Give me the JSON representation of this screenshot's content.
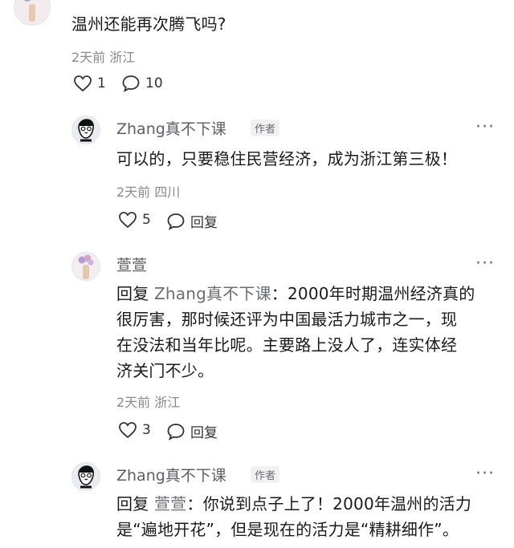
{
  "root_comment": {
    "text": "温州还能再次腾飞吗?",
    "meta": "2天前 浙江",
    "like_count": "1",
    "reply_count": "10"
  },
  "replies": [
    {
      "username": "Zhang真不下课",
      "badge": "作者",
      "text": "可以的，只要稳住民营经济，成为浙江第三极！",
      "meta": "2天前 四川",
      "like_count": "5",
      "reply_label": "回复",
      "more": "···"
    },
    {
      "username": "萱萱",
      "reply_prefix": "回复",
      "reply_to": "Zhang真不下课",
      "lines": [
        "：2000年时期温州经济真的",
        "很厉害，那时候还评为中国最活力城市之一，现",
        "在没法和当年比呢。主要路上没人了，连实体经",
        "济关门不少。"
      ],
      "meta": "2天前 浙江",
      "like_count": "3",
      "reply_label": "回复",
      "more": "···"
    },
    {
      "username": "Zhang真不下课",
      "badge": "作者",
      "reply_prefix": "回复",
      "reply_to": "萱萱",
      "lines": [
        "：你说到点子上了！2000年温州的活力",
        "是“遍地开花”，但是现在的活力是“精耕细作”。"
      ],
      "more": "···"
    }
  ]
}
